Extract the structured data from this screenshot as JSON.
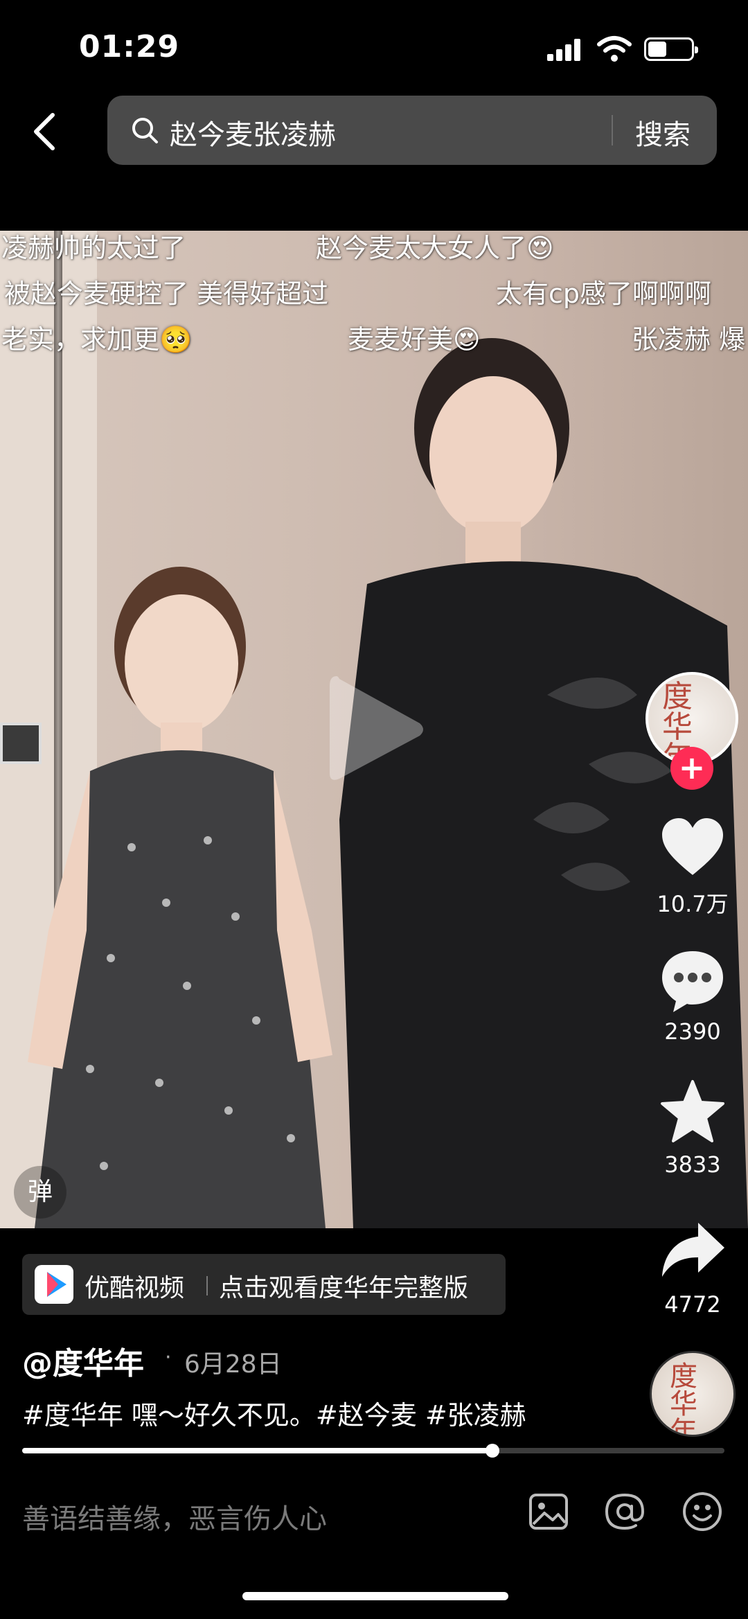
{
  "status_bar": {
    "time": "01:29"
  },
  "search": {
    "query": "赵今麦张凌赫",
    "submit_label": "搜索"
  },
  "danmaku": [
    {
      "text": "凌赫帅的太过了",
      "emoji": ""
    },
    {
      "text": "赵今麦太大女人了",
      "emoji": "😍"
    },
    {
      "text": "被赵今麦硬控了 美得好超过",
      "emoji": ""
    },
    {
      "text": "太有cp感了啊啊啊",
      "emoji": ""
    },
    {
      "text": "老实，求加更",
      "emoji": "🥺"
    },
    {
      "text": "麦麦好美",
      "emoji": "😍"
    },
    {
      "text": "张凌赫 爆",
      "emoji": ""
    }
  ],
  "video": {
    "danmu_toggle": "弹"
  },
  "rail": {
    "avatar_text": "度华年",
    "follow_symbol": "+",
    "likes": "10.7万",
    "comments": "2390",
    "favorites": "3833",
    "shares": "4772"
  },
  "promo": {
    "app_name": "优酷视频",
    "cta": "点击观看度华年完整版"
  },
  "post": {
    "username": "@度华年",
    "dot": "·",
    "date": "6月28日",
    "caption": "#度华年 嘿～好久不见。#赵今麦 #张凌赫",
    "progress": 0.67
  },
  "music_disc_text": "度华年",
  "comment_bar": {
    "placeholder": "善语结善缘，恶言伤人心"
  },
  "colors": {
    "accent": "#fe2c55",
    "search_bg": "#4a4a4a",
    "promo_bg": "#2a2a2a"
  }
}
